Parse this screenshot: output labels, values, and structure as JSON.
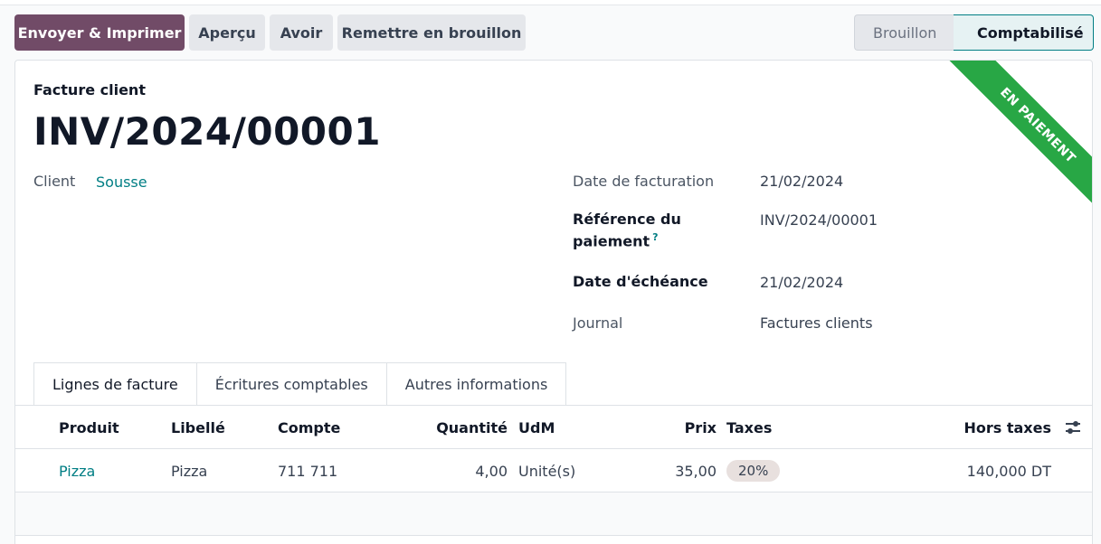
{
  "toolbar": {
    "send_print": "Envoyer & Imprimer",
    "preview": "Aperçu",
    "credit_note": "Avoir",
    "reset_draft": "Remettre en brouillon"
  },
  "status": {
    "steps": [
      "Brouillon",
      "Comptabilisé"
    ],
    "active": "Comptabilisé"
  },
  "ribbon": "EN PAIEMENT",
  "invoice": {
    "type_label": "Facture client",
    "number": "INV/2024/00001",
    "client_label": "Client",
    "client": "Sousse",
    "invoice_date_label": "Date de facturation",
    "invoice_date": "21/02/2024",
    "payment_ref_label_1": "Référence du",
    "payment_ref_label_2": "paiement",
    "payment_ref_help": "?",
    "payment_ref": "INV/2024/00001",
    "due_date_label": "Date d'échéance",
    "due_date": "21/02/2024",
    "journal_label": "Journal",
    "journal": "Factures clients"
  },
  "tabs": [
    {
      "label": "Lignes de facture",
      "active": true
    },
    {
      "label": "Écritures comptables",
      "active": false
    },
    {
      "label": "Autres informations",
      "active": false
    }
  ],
  "lines": {
    "columns": {
      "product": "Produit",
      "label": "Libellé",
      "account": "Compte",
      "quantity": "Quantité",
      "uom": "UdM",
      "price": "Prix",
      "taxes": "Taxes",
      "subtotal": "Hors taxes"
    },
    "rows": [
      {
        "product": "Pizza",
        "label": "Pizza",
        "account": "711 711",
        "quantity": "4,00",
        "uom": "Unité(s)",
        "price": "35,00",
        "taxes": "20%",
        "subtotal": "140,000 DT"
      }
    ]
  },
  "colors": {
    "primary": "#714b67",
    "accent": "#017e84",
    "ribbon": "#28a745"
  },
  "icons": {
    "column_settings": "sliders-icon"
  }
}
